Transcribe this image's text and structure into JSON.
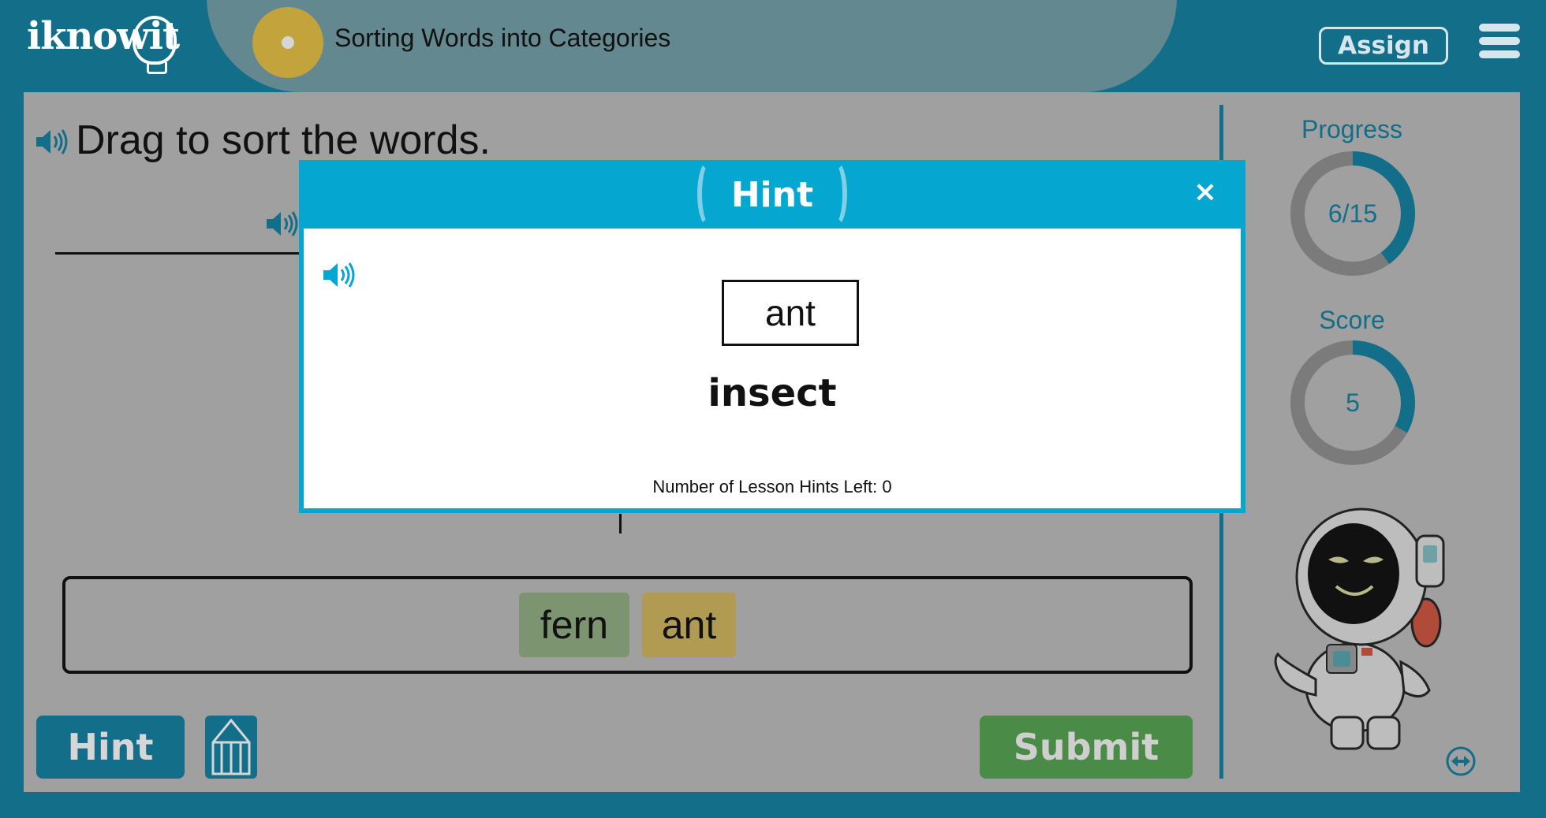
{
  "header": {
    "logo_text": "iknowit",
    "lesson_title": "Sorting Words into Categories",
    "assign_label": "Assign"
  },
  "main": {
    "instruction": "Drag to sort the words.",
    "word_bank": [
      "fern",
      "ant"
    ],
    "hint_label": "Hint",
    "submit_label": "Submit"
  },
  "stats": {
    "progress_label": "Progress",
    "progress_value": "6/15",
    "progress_fraction": 0.4,
    "score_label": "Score",
    "score_value": "5",
    "score_fraction": 0.33
  },
  "modal": {
    "title": "Hint",
    "close_label": "×",
    "word": "ant",
    "category": "insect",
    "hints_left_text": "Number of Lesson Hints Left: 0"
  },
  "colors": {
    "brand_teal": "#136e89",
    "modal_blue": "#05a7d0",
    "submit_green": "#4a8c47",
    "fern_tile": "#7c946f",
    "ant_tile": "#b19a52"
  },
  "icons": [
    "speaker-icon",
    "menu-icon",
    "close-icon",
    "pencil-icon",
    "swap-icon"
  ]
}
